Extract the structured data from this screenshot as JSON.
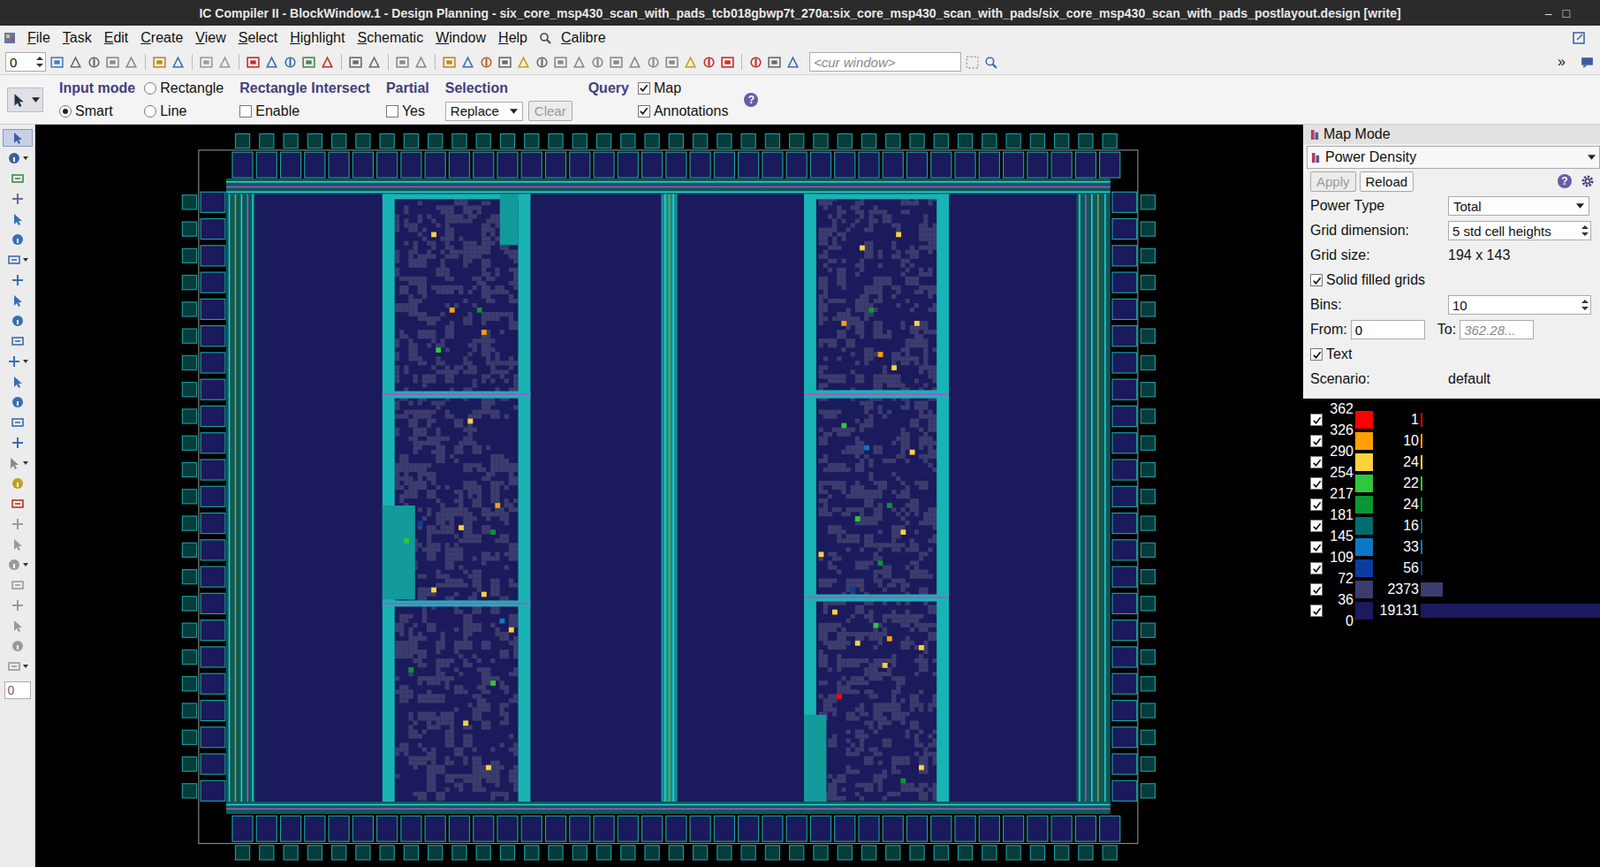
{
  "window": {
    "title": "IC Compiler II - BlockWindow.1 - Design Planning - six_core_msp430_scan_with_pads_tcb018gbwp7t_270a:six_core_msp430_scan_with_pads/six_core_msp430_scan_with_pads_postlayout.design [write]",
    "controls": [
      "–",
      "□"
    ]
  },
  "menu": [
    {
      "label": "File"
    },
    {
      "label": "Task"
    },
    {
      "label": "Edit"
    },
    {
      "label": "Create"
    },
    {
      "label": "View"
    },
    {
      "label": "Select"
    },
    {
      "label": "Highlight"
    },
    {
      "label": "Schematic"
    },
    {
      "label": "Window"
    },
    {
      "label": "Help"
    },
    {
      "label": "Calibre"
    }
  ],
  "toolbar": {
    "spinner": "0",
    "window_field": {
      "value": "",
      "placeholder": "<cur window>"
    },
    "overflow": "»"
  },
  "options_bar": {
    "input_mode": {
      "label": "Input mode",
      "options": [
        {
          "label": "Rectangle",
          "selected": false
        },
        {
          "label": "Smart",
          "selected": true
        },
        {
          "label": "Line",
          "selected": false
        }
      ]
    },
    "rectangle_intersect": {
      "label": "Rectangle Intersect",
      "option": {
        "label": "Enable",
        "checked": false
      }
    },
    "partial": {
      "label": "Partial",
      "option": {
        "label": "Yes",
        "checked": false
      }
    },
    "selection": {
      "label": "Selection",
      "value": "Replace",
      "button": {
        "label": "Clear",
        "disabled": true
      }
    },
    "query": {
      "label": "Query",
      "options": [
        {
          "label": "Map",
          "checked": true
        },
        {
          "label": "Annotations",
          "checked": true
        }
      ]
    },
    "help": "?"
  },
  "left_toolbar": {
    "spinner": "0"
  },
  "map_panel": {
    "title": "Map Mode",
    "mode": "Power Density",
    "buttons": [
      {
        "label": "Apply",
        "disabled": true
      },
      {
        "label": "Reload",
        "disabled": false
      }
    ],
    "help": "?",
    "fields": [
      {
        "kind": "select",
        "label": "Power Type",
        "value": "Total"
      },
      {
        "kind": "spinner",
        "label": "Grid dimension:",
        "value": "5 std cell heights"
      },
      {
        "kind": "text",
        "label": "Grid size:",
        "value": "194 x 143"
      },
      {
        "kind": "checkbox",
        "label": "Solid filled grids",
        "checked": true
      },
      {
        "kind": "spinner",
        "label": "Bins:",
        "value": "10"
      },
      {
        "kind": "range",
        "label": "From:",
        "value": "0",
        "to_label": "To:",
        "to_placeholder": "362.28..."
      },
      {
        "kind": "checkbox",
        "label": "Text",
        "checked": true
      },
      {
        "kind": "text",
        "label": "Scenario:",
        "value": "default"
      }
    ]
  },
  "legend": {
    "ticks": [
      "362",
      "326",
      "290",
      "254",
      "217",
      "181",
      "145",
      "109",
      "72",
      "36",
      "0"
    ],
    "bins": [
      {
        "color": "#ff0000",
        "count": "1",
        "level": 5e-05,
        "checked": true
      },
      {
        "color": "#ffa000",
        "count": "10",
        "level": 0.0005,
        "checked": true
      },
      {
        "color": "#ffd23c",
        "count": "24",
        "level": 0.0013,
        "checked": true
      },
      {
        "color": "#2dc83c",
        "count": "22",
        "level": 0.0012,
        "checked": true
      },
      {
        "color": "#0a9632",
        "count": "24",
        "level": 0.0013,
        "checked": true
      },
      {
        "color": "#006e6e",
        "count": "16",
        "level": 0.0008,
        "checked": true
      },
      {
        "color": "#0a78c8",
        "count": "33",
        "level": 0.0017,
        "checked": true
      },
      {
        "color": "#0a3ca0",
        "count": "56",
        "level": 0.0029,
        "checked": true
      },
      {
        "color": "#3c3c6e",
        "count": "2373",
        "level": 0.124,
        "checked": true
      },
      {
        "color": "#1b1a5c",
        "count": "19131",
        "level": 1,
        "checked": true
      }
    ]
  },
  "layout_view": {
    "hotspots": [
      {
        "col": 45,
        "row": 12,
        "bin": 2
      },
      {
        "col": 49,
        "row": 29,
        "bin": 1
      },
      {
        "col": 56,
        "row": 34,
        "bin": 1
      },
      {
        "col": 55,
        "row": 29,
        "bin": 4
      },
      {
        "col": 46,
        "row": 38,
        "bin": 3
      },
      {
        "col": 53,
        "row": 54,
        "bin": 2
      },
      {
        "col": 59,
        "row": 73,
        "bin": 1
      },
      {
        "col": 51,
        "row": 78,
        "bin": 2
      },
      {
        "col": 58,
        "row": 79,
        "bin": 4
      },
      {
        "col": 39,
        "row": 81,
        "bin": 3
      },
      {
        "col": 45,
        "row": 92,
        "bin": 2
      },
      {
        "col": 56,
        "row": 93,
        "bin": 2
      },
      {
        "col": 60,
        "row": 99,
        "bin": 6
      },
      {
        "col": 62,
        "row": 101,
        "bin": 2
      },
      {
        "col": 58,
        "row": 113,
        "bin": 3
      },
      {
        "col": 40,
        "row": 110,
        "bin": 4
      },
      {
        "col": 52,
        "row": 122,
        "bin": 2
      },
      {
        "col": 57,
        "row": 132,
        "bin": 2
      },
      {
        "col": 42,
        "row": 77,
        "bin": 7
      },
      {
        "col": 139,
        "row": 15,
        "bin": 2
      },
      {
        "col": 147,
        "row": 12,
        "bin": 2
      },
      {
        "col": 135,
        "row": 32,
        "bin": 1
      },
      {
        "col": 141,
        "row": 29,
        "bin": 4
      },
      {
        "col": 151,
        "row": 32,
        "bin": 2
      },
      {
        "col": 143,
        "row": 39,
        "bin": 1
      },
      {
        "col": 146,
        "row": 42,
        "bin": 2
      },
      {
        "col": 135,
        "row": 55,
        "bin": 3
      },
      {
        "col": 150,
        "row": 61,
        "bin": 2
      },
      {
        "col": 145,
        "row": 73,
        "bin": 4
      },
      {
        "col": 138,
        "row": 76,
        "bin": 3
      },
      {
        "col": 148,
        "row": 79,
        "bin": 2
      },
      {
        "col": 130,
        "row": 84,
        "bin": 2
      },
      {
        "col": 143,
        "row": 86,
        "bin": 4
      },
      {
        "col": 133,
        "row": 97,
        "bin": 2
      },
      {
        "col": 142,
        "row": 100,
        "bin": 3
      },
      {
        "col": 145,
        "row": 103,
        "bin": 1
      },
      {
        "col": 138,
        "row": 104,
        "bin": 2
      },
      {
        "col": 152,
        "row": 105,
        "bin": 2
      },
      {
        "col": 134,
        "row": 116,
        "bin": 0
      },
      {
        "col": 144,
        "row": 109,
        "bin": 2
      },
      {
        "col": 152,
        "row": 132,
        "bin": 2
      },
      {
        "col": 148,
        "row": 135,
        "bin": 4
      },
      {
        "col": 140,
        "row": 60,
        "bin": 6
      },
      {
        "col": 137,
        "row": 92,
        "bin": 7
      }
    ]
  }
}
